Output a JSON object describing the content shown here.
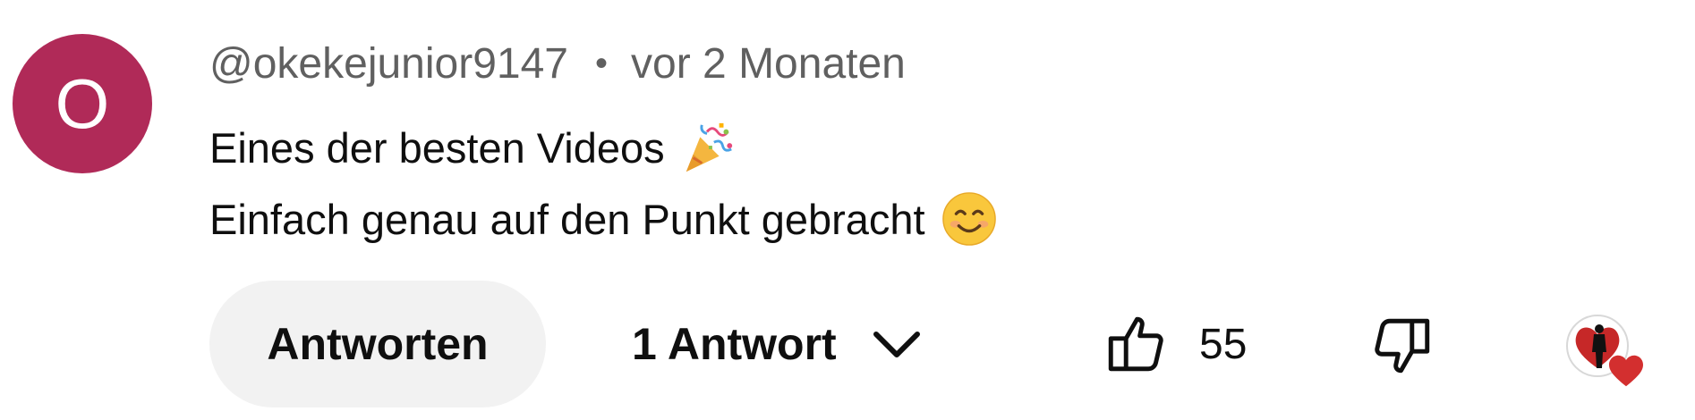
{
  "comment": {
    "avatar_letter": "O",
    "avatar_color": "#b02a58",
    "author": "@okekejunior9147",
    "separator": "•",
    "time": "vor 2 Monaten",
    "line1": "Eines der besten Videos",
    "line1_emoji": "party-popper-icon",
    "line2": "Einfach genau auf den Punkt gebracht",
    "line2_emoji": "smiling-face-icon"
  },
  "actions": {
    "reply_label": "Antworten",
    "replies_label": "1 Antwort",
    "like_count": "55",
    "creator_heart": "creator-heart-icon"
  },
  "colors": {
    "text": "#0f0f0f",
    "meta": "#606060",
    "reply_bg": "#f2f2f2",
    "heart": "#d32f2f"
  }
}
